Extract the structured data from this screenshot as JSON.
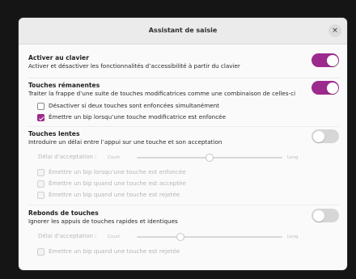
{
  "window": {
    "title": "Assistant de saisie",
    "close_glyph": "×"
  },
  "accent_color": "#9c2a8c",
  "sections": {
    "keyboard": {
      "title": "Activer au clavier",
      "description": "Activer et désactiver les fonctionnalités d’accessibilité à partir du clavier",
      "enabled": true
    },
    "sticky": {
      "title": "Touches rémanentes",
      "description": "Traiter la frappe d’une suite de touches modificatrices comme une combinaison de celles-ci",
      "enabled": true,
      "options": [
        {
          "label": "Désactiver si deux touches sont enfoncées simultanément",
          "checked": false
        },
        {
          "label": "Émettre un bip lorsqu’une touche modificatrice est enfoncée",
          "checked": true
        }
      ]
    },
    "slow": {
      "title": "Touches lentes",
      "description": "Introduire un délai entre l’appui sur une touche et son acceptation",
      "enabled": false,
      "delay_label": "Délai d’acceptation :",
      "scale_min": "Court",
      "scale_max": "Long",
      "delay_level": 0.5,
      "options": [
        {
          "label": "Émettre un bip lorsqu’une touche est enfoncée",
          "checked": false
        },
        {
          "label": "Émettre un bip quand une touche est acceptée",
          "checked": false
        },
        {
          "label": "Émettre un bip quand une touche est rejetée",
          "checked": false
        }
      ]
    },
    "bounce": {
      "title": "Rebonds de touches",
      "description": "Ignorer les appuis de touches rapides et identiques",
      "enabled": false,
      "delay_label": "Délai d’acceptation :",
      "scale_min": "Court",
      "scale_max": "Long",
      "delay_level": 0.3,
      "options": [
        {
          "label": "Émettre un bip quand une touche est rejetée",
          "checked": false
        }
      ]
    }
  }
}
